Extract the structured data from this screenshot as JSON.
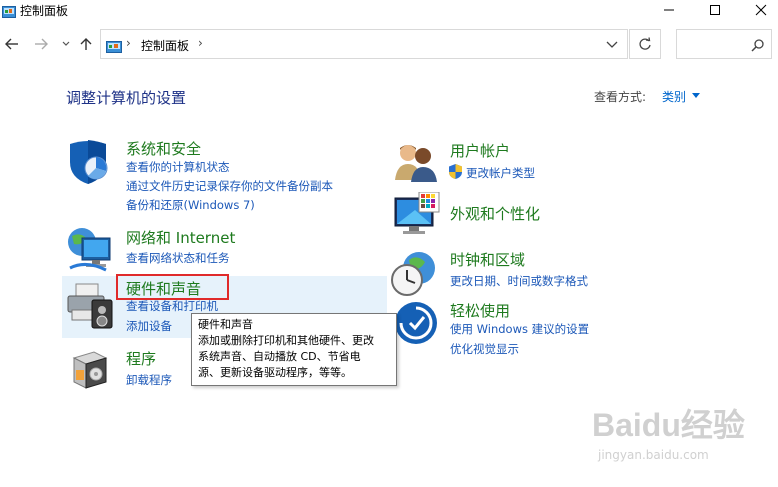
{
  "window": {
    "title": "控制面板",
    "min_icon": "minimize-icon",
    "max_icon": "maximize-icon",
    "close_icon": "close-icon"
  },
  "nav": {
    "address_path": "控制面板",
    "search_placeholder": ""
  },
  "heading": {
    "title": "调整计算机的设置",
    "view_by_label": "查看方式:",
    "view_by_value": "类别"
  },
  "categories": [
    {
      "title": "系统和安全",
      "icon": "shield-icon",
      "links": [
        "查看你的计算机状态",
        "通过文件历史记录保存你的文件备份副本",
        "备份和还原(Windows 7)"
      ]
    },
    {
      "title": "网络和 Internet",
      "icon": "network-globe-icon",
      "links": [
        "查看网络状态和任务"
      ]
    },
    {
      "title": "硬件和声音",
      "icon": "printer-speaker-icon",
      "links": [
        "查看设备和打印机",
        "添加设备"
      ]
    },
    {
      "title": "程序",
      "icon": "programs-box-icon",
      "links": [
        "卸载程序"
      ]
    },
    {
      "title": "用户帐户",
      "icon": "users-icon",
      "links": [
        "更改帐户类型"
      ]
    },
    {
      "title": "外观和个性化",
      "icon": "monitor-palette-icon",
      "links": []
    },
    {
      "title": "时钟和区域",
      "icon": "clock-globe-icon",
      "links": [
        "更改日期、时间或数字格式"
      ]
    },
    {
      "title": "轻松使用",
      "icon": "ease-of-access-icon",
      "links": [
        "使用 Windows 建议的设置",
        "优化视觉显示"
      ]
    }
  ],
  "tooltip": {
    "title": "硬件和声音",
    "line1": "添加或删除打印机和其他硬件、更改",
    "line2": "系统声音、自动播放 CD、节省电",
    "line3": "源、更新设备驱动程序，等等。"
  },
  "watermark": {
    "main": "Baidu经验",
    "sub": "jingyan.baidu.com"
  },
  "colors": {
    "title_green": "#1e7a1e",
    "link_blue": "#1c58b8",
    "heading_blue": "#1e3287",
    "highlight": "#e02a2a"
  }
}
